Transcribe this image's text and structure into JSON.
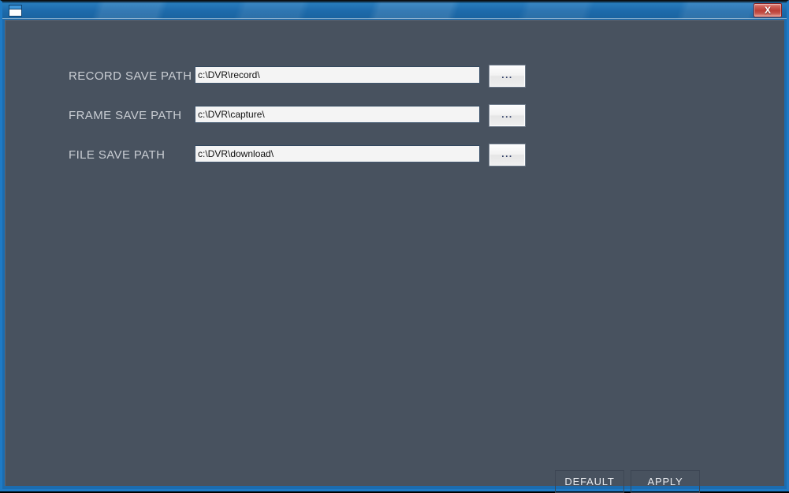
{
  "window": {
    "title": "",
    "icon": "window-icon",
    "close_label": "X",
    "accent_color": "#1b6cb0",
    "client_bg": "#48525f"
  },
  "form": {
    "rows": [
      {
        "label": "RECORD SAVE PATH",
        "value": "c:\\DVR\\record\\",
        "placeholder": "",
        "browse_label": "..."
      },
      {
        "label": "FRAME SAVE PATH",
        "value": "c:\\DVR\\capture\\",
        "placeholder": "",
        "browse_label": "..."
      },
      {
        "label": "FILE SAVE PATH",
        "value": "c:\\DVR\\download\\",
        "placeholder": "",
        "browse_label": "..."
      }
    ]
  },
  "footer": {
    "default_label": "DEFAULT",
    "apply_label": "APPLY"
  }
}
